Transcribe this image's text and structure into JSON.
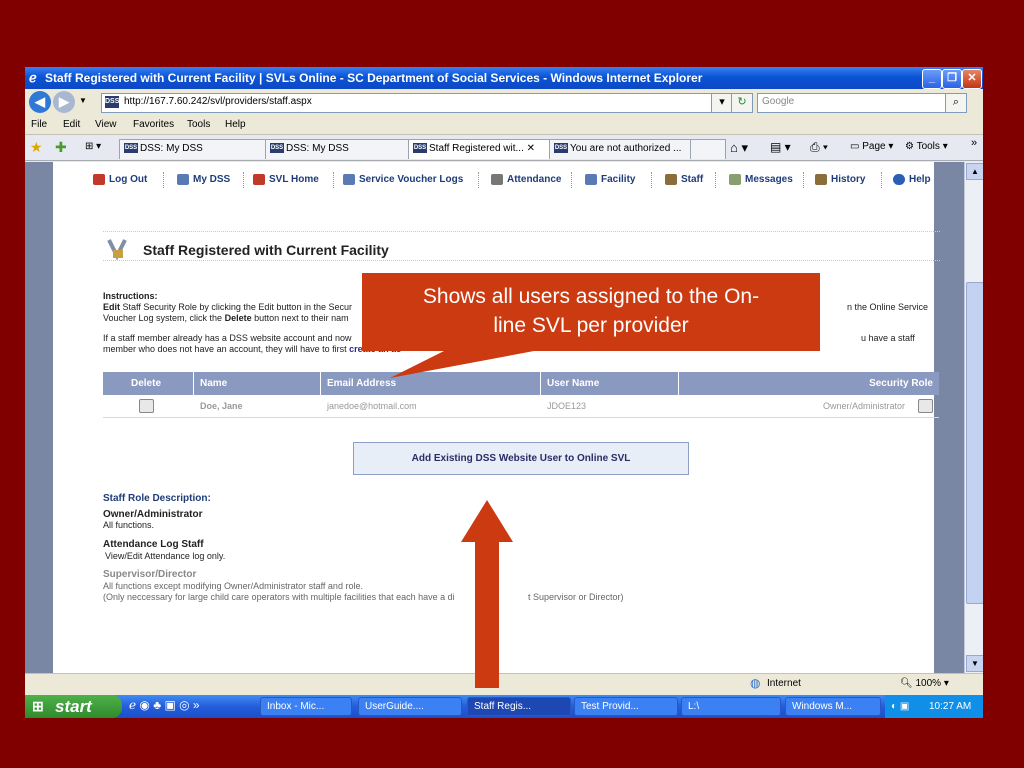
{
  "window": {
    "title": "Staff Registered with Current Facility | SVLs Online - SC Department of Social Services - Windows Internet Explorer",
    "minimize": "_",
    "maximize": "❐",
    "close": "✕"
  },
  "addressbar": {
    "badge": "DSS",
    "url": "http://167.7.60.242/svl/providers/staff.aspx",
    "search_placeholder": "Google"
  },
  "menu": [
    "File",
    "Edit",
    "View",
    "Favorites",
    "Tools",
    "Help"
  ],
  "tabs": [
    {
      "label": "DSS: My DSS"
    },
    {
      "label": "DSS: My DSS"
    },
    {
      "label": "Staff Registered wit... ✕"
    },
    {
      "label": "You are not authorized ..."
    }
  ],
  "toolbar": {
    "page": "Page",
    "tools": "Tools"
  },
  "site_nav": [
    {
      "label": "Log Out",
      "color": "#C0392B"
    },
    {
      "label": "My DSS",
      "color": "#5A7AB5"
    },
    {
      "label": "SVL Home",
      "color": "#C0392B"
    },
    {
      "label": "Service Voucher Logs",
      "color": "#5A7AB5"
    },
    {
      "label": "Attendance",
      "color": "#777777"
    },
    {
      "label": "Facility",
      "color": "#5A7AB5"
    },
    {
      "label": "Staff",
      "color": "#8A6D3B"
    },
    {
      "label": "Messages",
      "color": "#88A070"
    },
    {
      "label": "History",
      "color": "#8A6D3B"
    },
    {
      "label": "Help",
      "color": "#2A5FB5"
    }
  ],
  "page": {
    "title": "Staff Registered with Current Facility",
    "instructions_heading": "Instructions:",
    "line1_bold": "Edit",
    "line1_rest": "Staff Security Role by clicking the Edit button in the Secur",
    "line1_right": "n the Online Service",
    "line2_a": "Voucher Log system, click the",
    "line2_bold": "Delete",
    "line2_b": "button next to their nam",
    "line3": "If a staff member already has a DSS website account and now",
    "line3_right": "u have a staff",
    "line4_a": "member who does not have an account, they will have to first",
    "line4_link": "create an ac"
  },
  "table": {
    "headers": {
      "delete": "Delete",
      "name": "Name",
      "email": "Email Address",
      "username": "User Name",
      "role": "Security Role"
    },
    "rows": [
      {
        "name": "Doe, Jane",
        "email": "janedoe@hotmail.com",
        "username": "JDOE123",
        "role": "Owner/Administrator"
      }
    ]
  },
  "add_button": "Add Existing DSS Website User to Online SVL",
  "roles": {
    "heading": "Staff Role Description:",
    "owner_title": "Owner/Administrator",
    "owner_desc": "All functions.",
    "attendance_title": "Attendance Log Staff",
    "attendance_desc": "View/Edit Attendance log only.",
    "supervisor_title": "Supervisor/Director",
    "supervisor_desc1": "All functions except modifying Owner/Administrator staff and role.",
    "supervisor_desc2a": "(Only neccessary for large child care operators with multiple facilities that each have a di",
    "supervisor_desc2b": "t Supervisor or Director)"
  },
  "statusbar": {
    "zone": "Internet",
    "zoom": "100%"
  },
  "taskbar": {
    "start": "start",
    "items": [
      "Inbox - Mic...",
      "UserGuide....",
      "Staff Regis...",
      "Test Provid...",
      "L:\\",
      "Windows M..."
    ],
    "clock": "10:27 AM"
  },
  "callout": {
    "line1": "Shows all users assigned to the On-",
    "line2": "line SVL per provider",
    "color": "#CC3A11"
  }
}
